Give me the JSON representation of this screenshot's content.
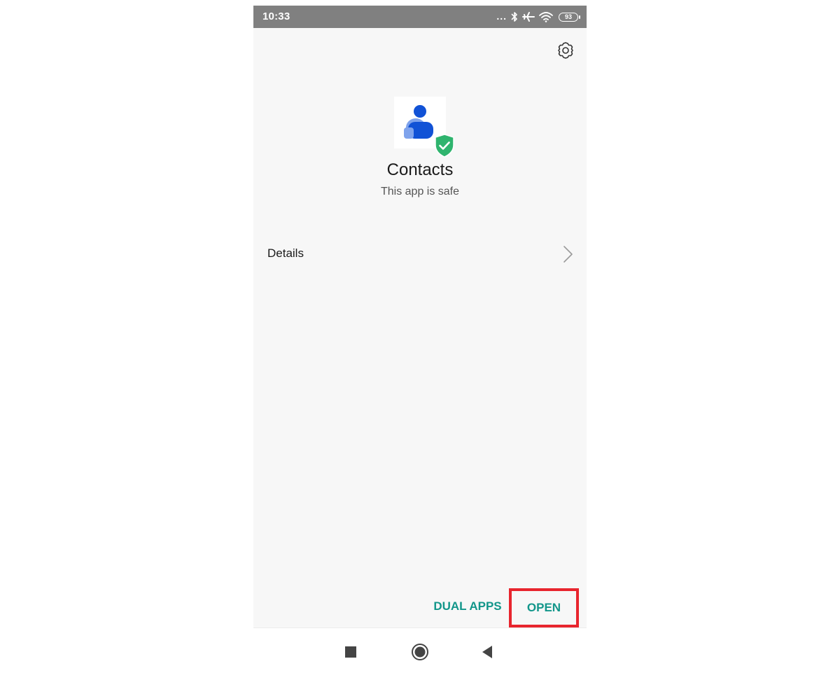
{
  "status_bar": {
    "time": "10:33",
    "overflow_dots": "...",
    "battery_level": "93"
  },
  "app": {
    "name": "Contacts",
    "security_status": "This app is safe"
  },
  "details": {
    "label": "Details"
  },
  "actions": {
    "dual_apps_label": "DUAL APPS",
    "open_label": "OPEN"
  },
  "colors": {
    "accent": "#12968a",
    "highlight_border": "#e8252e",
    "safe_badge": "#2fb46e",
    "contact_icon_primary": "#1152d6",
    "contact_icon_secondary": "#7fa3ec"
  },
  "icons": {
    "settings": "gear-icon",
    "app": "contacts-app-icon",
    "badge": "shield-check-icon",
    "details": "chevron-right-icon",
    "nav": [
      "square-recents-icon",
      "circle-home-icon",
      "triangle-back-icon"
    ]
  }
}
